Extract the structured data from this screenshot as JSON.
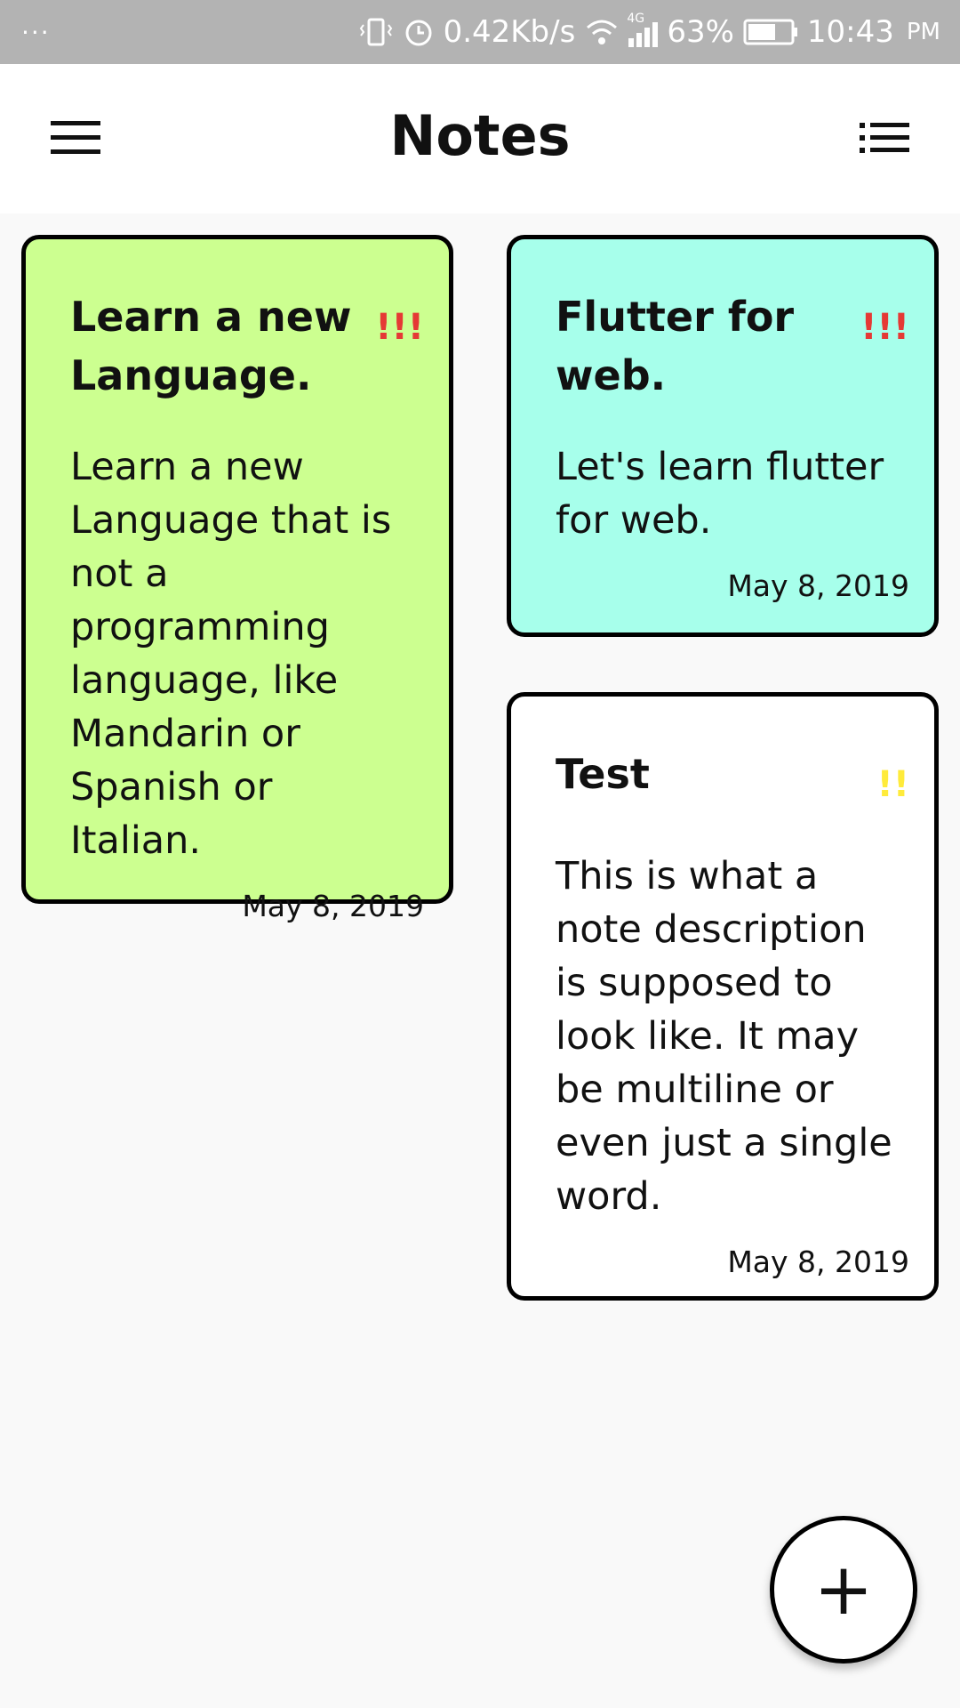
{
  "status_bar": {
    "dots": "···",
    "speed": "0.42Kb/s",
    "network": "4G",
    "battery": "63%",
    "time": "10:43",
    "ampm": "PM"
  },
  "app_bar": {
    "title": "Notes",
    "menu_icon": "hamburger-menu-icon",
    "view_icon": "list-view-icon"
  },
  "notes": [
    {
      "title": "Learn a new Language.",
      "priority": "!!!",
      "priority_color": "#e53935",
      "bg": "#ccff90",
      "description": "Learn a new Language that is not a programming language, like Mandarin or Spanish or Italian.",
      "date": "May 8, 2019"
    },
    {
      "title": "Flutter for web.",
      "priority": "!!!",
      "priority_color": "#e53935",
      "bg": "#a7ffeb",
      "description": "Let's learn flutter for web.",
      "date": "May 8, 2019"
    },
    {
      "title": "Test",
      "priority": "!!",
      "priority_color": "#ffeb3b",
      "bg": "#ffffff",
      "description": "This is what a note description is supposed to look like. It may be multiline or even just a single word.",
      "date": "May 8, 2019"
    }
  ],
  "fab": {
    "label": "+"
  }
}
